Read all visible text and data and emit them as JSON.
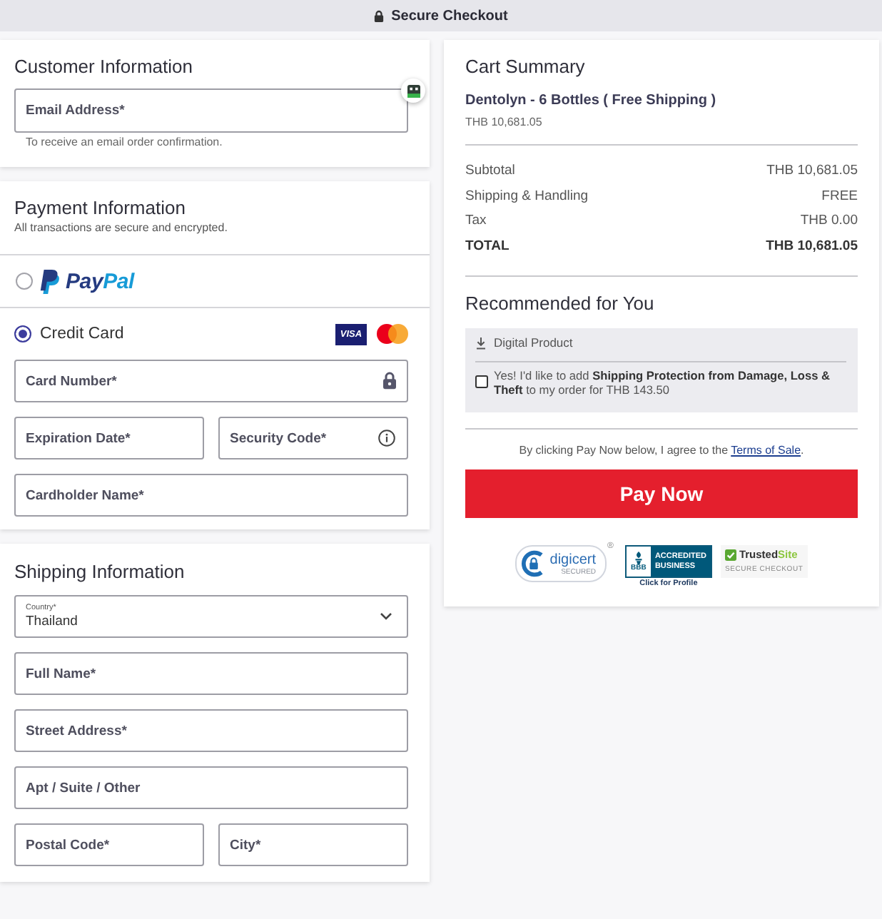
{
  "top_bar": {
    "title": "Secure Checkout"
  },
  "customer": {
    "title": "Customer Information",
    "email": {
      "placeholder": "Email Address*"
    },
    "hint": "To receive an email order confirmation."
  },
  "payment": {
    "title": "Payment Information",
    "subtitle": "All transactions are secure and encrypted.",
    "methods": [
      {
        "kind": "paypal",
        "wordmark": [
          "Pay",
          "Pal"
        ],
        "selected": false
      },
      {
        "kind": "card",
        "label": "Credit Card",
        "selected": true,
        "brands": [
          {
            "kind": "visa",
            "label": "VISA"
          },
          {
            "kind": "mastercard"
          }
        ]
      }
    ],
    "card_fields": [
      [
        {
          "placeholder": "Card Number*",
          "kind": "locked"
        }
      ],
      [
        {
          "placeholder": "Expiration Date*",
          "kind": "plain"
        },
        {
          "placeholder": "Security Code*",
          "kind": "help"
        }
      ],
      [
        {
          "placeholder": "Cardholder Name*",
          "kind": "plain"
        }
      ]
    ]
  },
  "shipping": {
    "title": "Shipping Information",
    "country": {
      "label": "Country*",
      "value": "Thailand"
    },
    "fields": [
      [
        {
          "placeholder": "Full Name*"
        }
      ],
      [
        {
          "placeholder": "Street Address*"
        }
      ],
      [
        {
          "placeholder": "Apt / Suite / Other"
        }
      ],
      [
        {
          "placeholder": "Postal Code*"
        },
        {
          "placeholder": "City*"
        }
      ]
    ]
  },
  "cart": {
    "title": "Cart Summary",
    "product": {
      "name": "Dentolyn - 6 Bottles ( Free Shipping )",
      "price": "THB 10,681.05"
    },
    "lines": [
      {
        "label": "Subtotal",
        "value": "THB 10,681.05",
        "kind": "line"
      },
      {
        "label": "Shipping & Handling",
        "value": "FREE",
        "kind": "line"
      },
      {
        "label": "Tax",
        "value": "THB 0.00",
        "kind": "line"
      },
      {
        "label": "TOTAL",
        "value": "THB 10,681.05",
        "kind": "total"
      }
    ]
  },
  "recommended": {
    "title": "Recommended for You",
    "tag": "Digital Product",
    "offer": {
      "checked": false,
      "text": "Yes! I'd like to add **Shipping Protection from Damage, Loss & Theft** to my order for THB 143.50"
    }
  },
  "agreement": {
    "text": "By clicking Pay Now below, I agree to the",
    "link": "Terms of Sale",
    "end": "."
  },
  "pay_button": {
    "label": "Pay Now"
  },
  "badges": [
    {
      "kind": "digicert",
      "name": "digicert",
      "caption": "SECURED",
      "mark": "®"
    },
    {
      "kind": "bbb",
      "seal": "BBB",
      "name": "ACCREDITED BUSINESS",
      "caption": "Click for Profile"
    },
    {
      "kind": "trustedsite",
      "name_parts": [
        "Trusted",
        "Site"
      ],
      "caption": "SECURE CHECKOUT"
    }
  ]
}
